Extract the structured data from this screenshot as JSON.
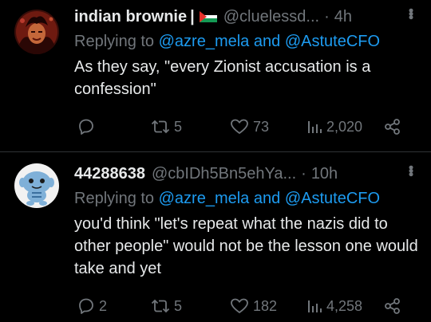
{
  "tweets": [
    {
      "display_name": "indian brownie",
      "separator": "|",
      "handle": "@cluelessd...",
      "dot": "·",
      "time": "4h",
      "replying_prefix": "Replying to",
      "reply_user1": "@azre_mela",
      "reply_and": "and",
      "reply_user2": "@AstuteCFO",
      "text": "As they say, \"every Zionist accusation is a confession\"",
      "replies": "",
      "retweets": "5",
      "likes": "73",
      "views": "2,020"
    },
    {
      "display_name": "44288638",
      "handle": "@cbIDh5Bn5ehYa...",
      "dot": "·",
      "time": "10h",
      "replying_prefix": "Replying to",
      "reply_user1": "@azre_mela",
      "reply_and": "and",
      "reply_user2": "@AstuteCFO",
      "text": "you'd think \"let's repeat what the nazis did to other people\" would not be the lesson one would take and yet",
      "replies": "2",
      "retweets": "5",
      "likes": "182",
      "views": "4,258"
    }
  ],
  "colors": {
    "background": "#000000",
    "text": "#e7e9ea",
    "secondary": "#71767b",
    "link": "#1d9bf0",
    "divider": "#2f3336"
  },
  "icons": {
    "reply": "reply-icon",
    "retweet": "retweet-icon",
    "like": "heart-icon",
    "views": "views-icon",
    "share": "share-icon",
    "more": "more-icon",
    "flag": "palestine-flag-icon"
  }
}
